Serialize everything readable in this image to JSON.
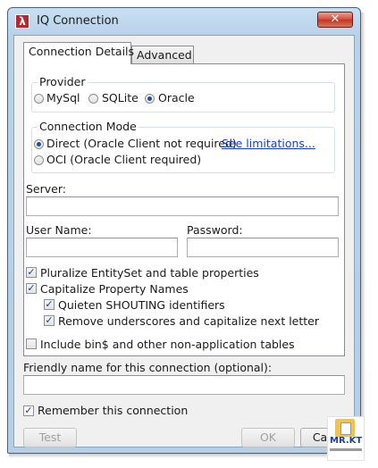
{
  "window": {
    "title": "IQ Connection",
    "close_label": "✕"
  },
  "tabs": [
    {
      "label": "Connection Details"
    },
    {
      "label": "Advanced"
    }
  ],
  "provider": {
    "title": "Provider",
    "options": [
      {
        "label": "MySql"
      },
      {
        "label": "SQLite"
      },
      {
        "label": "Oracle"
      }
    ],
    "selected": "Oracle"
  },
  "connection_mode": {
    "title": "Connection Mode",
    "direct_label": "Direct (Oracle Client not required)",
    "limitations_link": "See limitations...",
    "oci_label": "OCI (Oracle Client required)",
    "selected": "Direct (Oracle Client not required)"
  },
  "fields": {
    "server_label": "Server:",
    "server_value": "",
    "username_label": "User Name:",
    "username_value": "",
    "password_label": "Password:",
    "password_value": ""
  },
  "options": {
    "pluralize": "Pluralize EntitySet and table properties",
    "capitalize": "Capitalize Property Names",
    "quieten": "Quieten SHOUTING identifiers",
    "remove_underscores": "Remove underscores and capitalize next letter",
    "include_bin": "Include bin$ and other non-application tables"
  },
  "friendly_name": {
    "label": "Friendly name for this connection (optional):",
    "value": ""
  },
  "remember_label": "Remember this connection",
  "buttons": {
    "test": "Test",
    "ok": "OK",
    "cancel": "Cancel"
  },
  "logo_text": "MR.KT",
  "colors": {
    "close_button": "#c94a38",
    "link": "#1b3fc6",
    "frame": "#b9d2ea"
  }
}
